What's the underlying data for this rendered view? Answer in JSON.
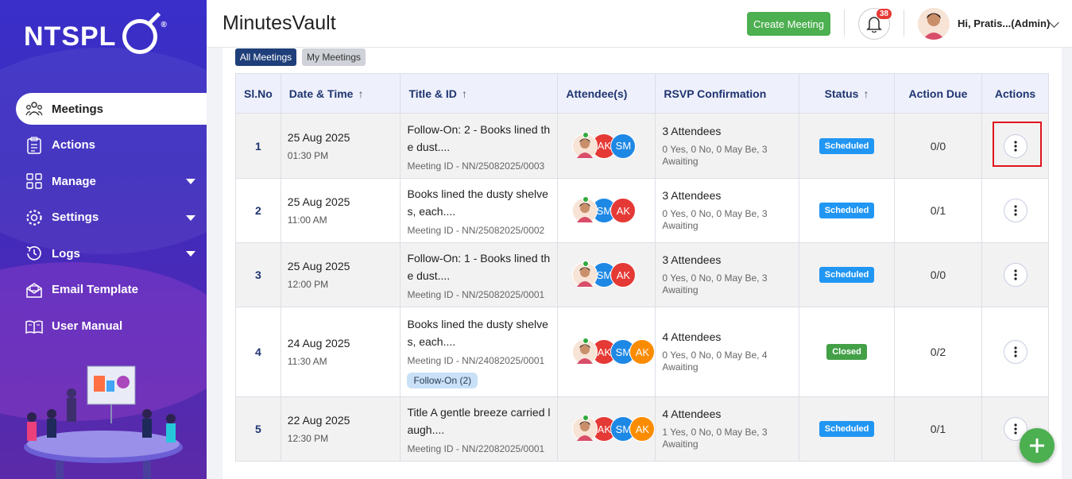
{
  "brand": {
    "logo_text": "NTSPL",
    "reg": "®"
  },
  "sidebar": {
    "items": [
      {
        "label": "Meetings",
        "icon": "meetings-icon",
        "active": true
      },
      {
        "label": "Actions",
        "icon": "actions-icon"
      },
      {
        "label": "Manage",
        "icon": "manage-icon",
        "has_caret": true
      },
      {
        "label": "Settings",
        "icon": "settings-icon",
        "has_caret": true
      },
      {
        "label": "Logs",
        "icon": "logs-icon",
        "has_caret": true
      },
      {
        "label": "Email Template",
        "icon": "email-icon"
      },
      {
        "label": "User Manual",
        "icon": "manual-icon"
      }
    ]
  },
  "header": {
    "title": "MinutesVault",
    "create_label": "Create Meeting",
    "notifications": "38",
    "user_name": "Hi, Pratis...(Admin)"
  },
  "tabs": {
    "all": "All Meetings",
    "my": "My Meetings"
  },
  "table": {
    "headers": {
      "sl": "Sl.No",
      "datetime": "Date & Time",
      "title": "Title & ID",
      "attendees": "Attendee(s)",
      "rsvp": "RSVP Confirmation",
      "status": "Status",
      "action_due": "Action Due",
      "actions": "Actions"
    },
    "rows": [
      {
        "sl": "1",
        "date": "25 Aug 2025",
        "time": "01:30 PM",
        "title": "Follow-On: 2 - Books lined the dust....",
        "meeting_id": "Meeting ID - NN/25082025/0003",
        "follow_on": "",
        "attendees": [
          "AK",
          "SM"
        ],
        "rsvp_count": "3 Attendees",
        "rsvp_detail": "0 Yes, 0 No, 0 May Be, 3 Awaiting",
        "status": "Scheduled",
        "action_due": "0/0"
      },
      {
        "sl": "2",
        "date": "25 Aug 2025",
        "time": "11:00 AM",
        "title": "Books lined the dusty shelves, each....",
        "meeting_id": "Meeting ID - NN/25082025/0002",
        "follow_on": "",
        "attendees": [
          "SM",
          "AK"
        ],
        "rsvp_count": "3 Attendees",
        "rsvp_detail": "0 Yes, 0 No, 0 May Be, 3 Awaiting",
        "status": "Scheduled",
        "action_due": "0/1"
      },
      {
        "sl": "3",
        "date": "25 Aug 2025",
        "time": "12:00 PM",
        "title": "Follow-On: 1 - Books lined the dust....",
        "meeting_id": "Meeting ID - NN/25082025/0001",
        "follow_on": "",
        "attendees": [
          "SM",
          "AK"
        ],
        "rsvp_count": "3 Attendees",
        "rsvp_detail": "0 Yes, 0 No, 0 May Be, 3 Awaiting",
        "status": "Scheduled",
        "action_due": "0/0"
      },
      {
        "sl": "4",
        "date": "24 Aug 2025",
        "time": "11:30 AM",
        "title": "Books lined the dusty shelves, each....",
        "meeting_id": "Meeting ID - NN/24082025/0001",
        "follow_on": "Follow-On (2)",
        "attendees": [
          "AK",
          "SM",
          "AK"
        ],
        "rsvp_count": "4 Attendees",
        "rsvp_detail": "0 Yes, 0 No, 0 May Be, 4 Awaiting",
        "status": "Closed",
        "action_due": "0/2"
      },
      {
        "sl": "5",
        "date": "22 Aug 2025",
        "time": "12:30 PM",
        "title": "Title A gentle breeze carried laugh....",
        "meeting_id": "Meeting ID - NN/22082025/0001",
        "follow_on": "",
        "attendees": [
          "AK",
          "SM",
          "AK"
        ],
        "rsvp_count": "4 Attendees",
        "rsvp_detail": "1 Yes, 0 No, 0 May Be, 3 Awaiting",
        "status": "Scheduled",
        "action_due": "0/1"
      }
    ]
  },
  "colors": {
    "accent": "#1f3f7a",
    "green": "#4caf50",
    "scheduled": "#2196f3",
    "closed": "#43a047"
  }
}
